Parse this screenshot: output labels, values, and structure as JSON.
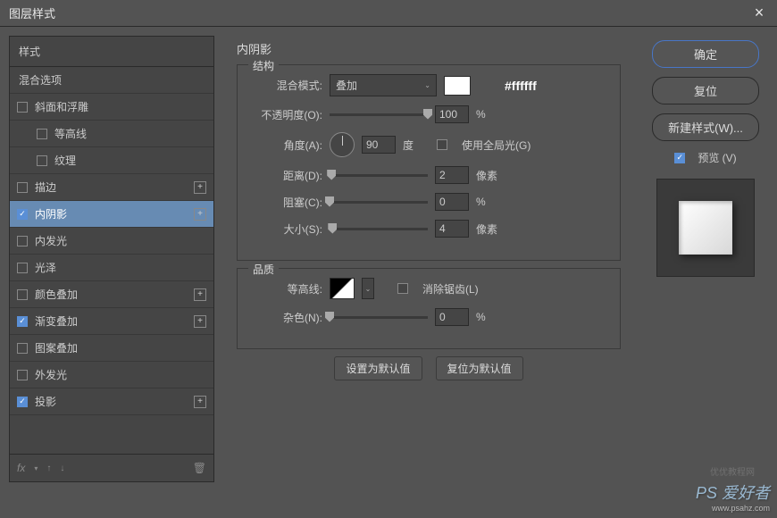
{
  "window": {
    "title": "图层样式"
  },
  "sidebar": {
    "styles_header": "样式",
    "blend_header": "混合选项",
    "items": [
      {
        "label": "斜面和浮雕",
        "checked": false,
        "add": false,
        "indent": false
      },
      {
        "label": "等高线",
        "checked": false,
        "add": false,
        "indent": true
      },
      {
        "label": "纹理",
        "checked": false,
        "add": false,
        "indent": true
      },
      {
        "label": "描边",
        "checked": false,
        "add": true,
        "indent": false
      },
      {
        "label": "内阴影",
        "checked": true,
        "add": true,
        "indent": false,
        "selected": true
      },
      {
        "label": "内发光",
        "checked": false,
        "add": false,
        "indent": false
      },
      {
        "label": "光泽",
        "checked": false,
        "add": false,
        "indent": false
      },
      {
        "label": "颜色叠加",
        "checked": false,
        "add": true,
        "indent": false
      },
      {
        "label": "渐变叠加",
        "checked": true,
        "add": true,
        "indent": false
      },
      {
        "label": "图案叠加",
        "checked": false,
        "add": false,
        "indent": false
      },
      {
        "label": "外发光",
        "checked": false,
        "add": false,
        "indent": false
      },
      {
        "label": "投影",
        "checked": true,
        "add": true,
        "indent": false
      }
    ],
    "fx": "fx"
  },
  "panel": {
    "title": "内阴影",
    "structure_label": "结构",
    "blend_mode_label": "混合模式:",
    "blend_mode_value": "叠加",
    "color_hex": "#ffffff",
    "opacity_label": "不透明度(O):",
    "opacity_value": "100",
    "opacity_unit": "%",
    "angle_label": "角度(A):",
    "angle_value": "90",
    "angle_unit": "度",
    "global_light_label": "使用全局光(G)",
    "distance_label": "距离(D):",
    "distance_value": "2",
    "distance_unit": "像素",
    "choke_label": "阻塞(C):",
    "choke_value": "0",
    "choke_unit": "%",
    "size_label": "大小(S):",
    "size_value": "4",
    "size_unit": "像素",
    "quality_label": "品质",
    "contour_label": "等高线:",
    "antialias_label": "消除锯齿(L)",
    "noise_label": "杂色(N):",
    "noise_value": "0",
    "noise_unit": "%",
    "set_default": "设置为默认值",
    "reset_default": "复位为默认值"
  },
  "right": {
    "ok": "确定",
    "cancel": "复位",
    "new_style": "新建样式(W)...",
    "preview": "预览 (V)"
  },
  "watermark": {
    "main": "PS 爱好者",
    "sub": "www.psahz.com",
    "alt": "优优教程网"
  }
}
